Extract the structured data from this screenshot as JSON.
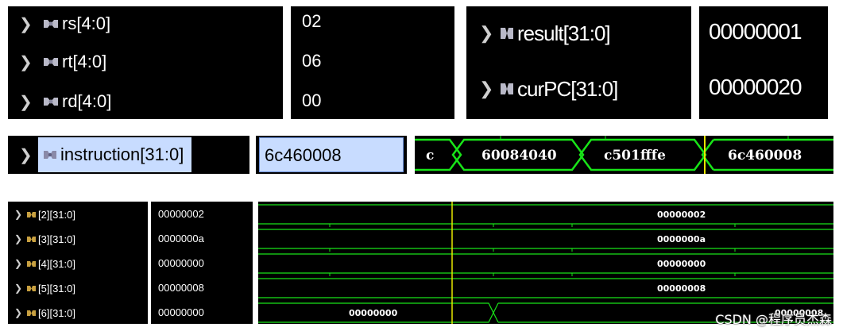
{
  "top_left_names": [
    {
      "label": "rs[4:0]"
    },
    {
      "label": "rt[4:0]"
    },
    {
      "label": "rd[4:0]"
    }
  ],
  "top_left_values": [
    "02",
    "06",
    "00"
  ],
  "top_right_names": [
    {
      "label": "result[31:0]"
    },
    {
      "label": "curPC[31:0]"
    }
  ],
  "top_right_values": [
    "00000001",
    "00000020"
  ],
  "instruction": {
    "label": "instruction[31:0]",
    "value": "6c460008",
    "wave_segments": [
      "c",
      "60084040",
      "c501fffe",
      "6c460008"
    ]
  },
  "registers": [
    {
      "label": "[2][31:0]",
      "value": "00000002",
      "wave_left": "",
      "wave_right": "00000002"
    },
    {
      "label": "[3][31:0]",
      "value": "0000000a",
      "wave_left": "",
      "wave_right": "0000000a"
    },
    {
      "label": "[4][31:0]",
      "value": "00000000",
      "wave_left": "",
      "wave_right": "00000000"
    },
    {
      "label": "[5][31:0]",
      "value": "00000008",
      "wave_left": "",
      "wave_right": "00000008"
    },
    {
      "label": "[6][31:0]",
      "value": "00000000",
      "wave_left": "00000000",
      "wave_right": "00000008"
    }
  ],
  "watermark": "CSDN @程序员杰森",
  "colors": {
    "panel_bg": "#000000",
    "wave_green": "#18e418",
    "cursor_yellow": "#e8e800",
    "selected_bg": "#c8dcff",
    "icon_color": "#b9b9c8"
  },
  "icons": {
    "expand": "chevron-right-icon",
    "bus": "bus-signal-icon"
  }
}
